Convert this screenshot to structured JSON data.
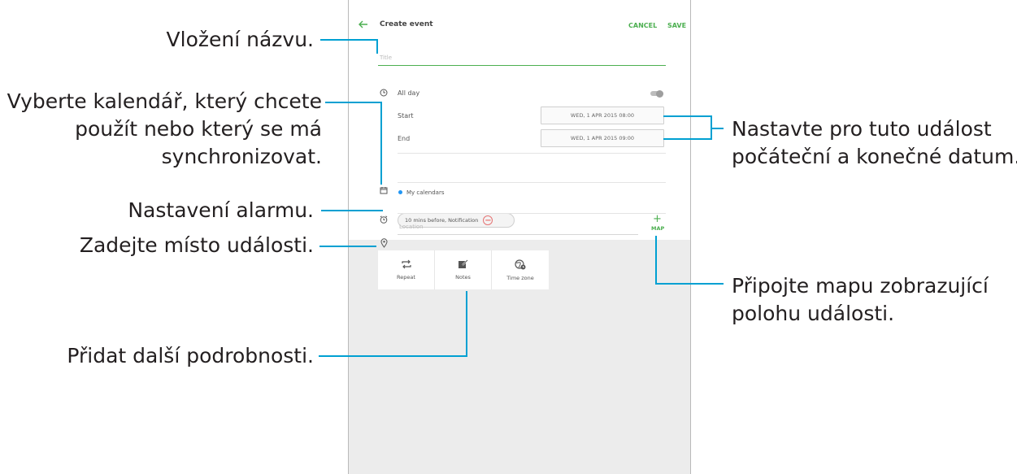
{
  "screen": {
    "title": "Create event",
    "cancel_label": "CANCEL",
    "save_label": "SAVE",
    "title_placeholder": "Title",
    "all_day_label": "All day",
    "start_label": "Start",
    "start_value": "WED, 1 APR 2015   08:00",
    "end_label": "End",
    "end_value": "WED, 1 APR 2015   09:00",
    "calendar_label": "My calendars",
    "calendar_dot_color": "#2196f3",
    "alarm_value": "10 mins before, Notification",
    "location_placeholder": "Location",
    "map_label": "MAP",
    "accent_color": "#4caf50",
    "options": [
      {
        "label": "Repeat",
        "icon": "repeat-icon"
      },
      {
        "label": "Notes",
        "icon": "notes-icon"
      },
      {
        "label": "Time zone",
        "icon": "time-zone-icon"
      }
    ]
  },
  "annotations": {
    "title": "Vložení názvu.",
    "calendar_line1": "Vyberte kalendář, který chcete",
    "calendar_line2": "použít nebo který se má",
    "calendar_line3": "synchronizovat.",
    "alarm": "Nastavení alarmu.",
    "location": "Zadejte místo události.",
    "details": "Přidat další podrobnosti.",
    "dates_line1": "Nastavte pro tuto událost",
    "dates_line2": "počáteční a konečné datum.",
    "map_line1": "Připojte mapu zobrazující",
    "map_line2": "polohu události."
  },
  "colors": {
    "callout_line": "#00a0d2"
  }
}
